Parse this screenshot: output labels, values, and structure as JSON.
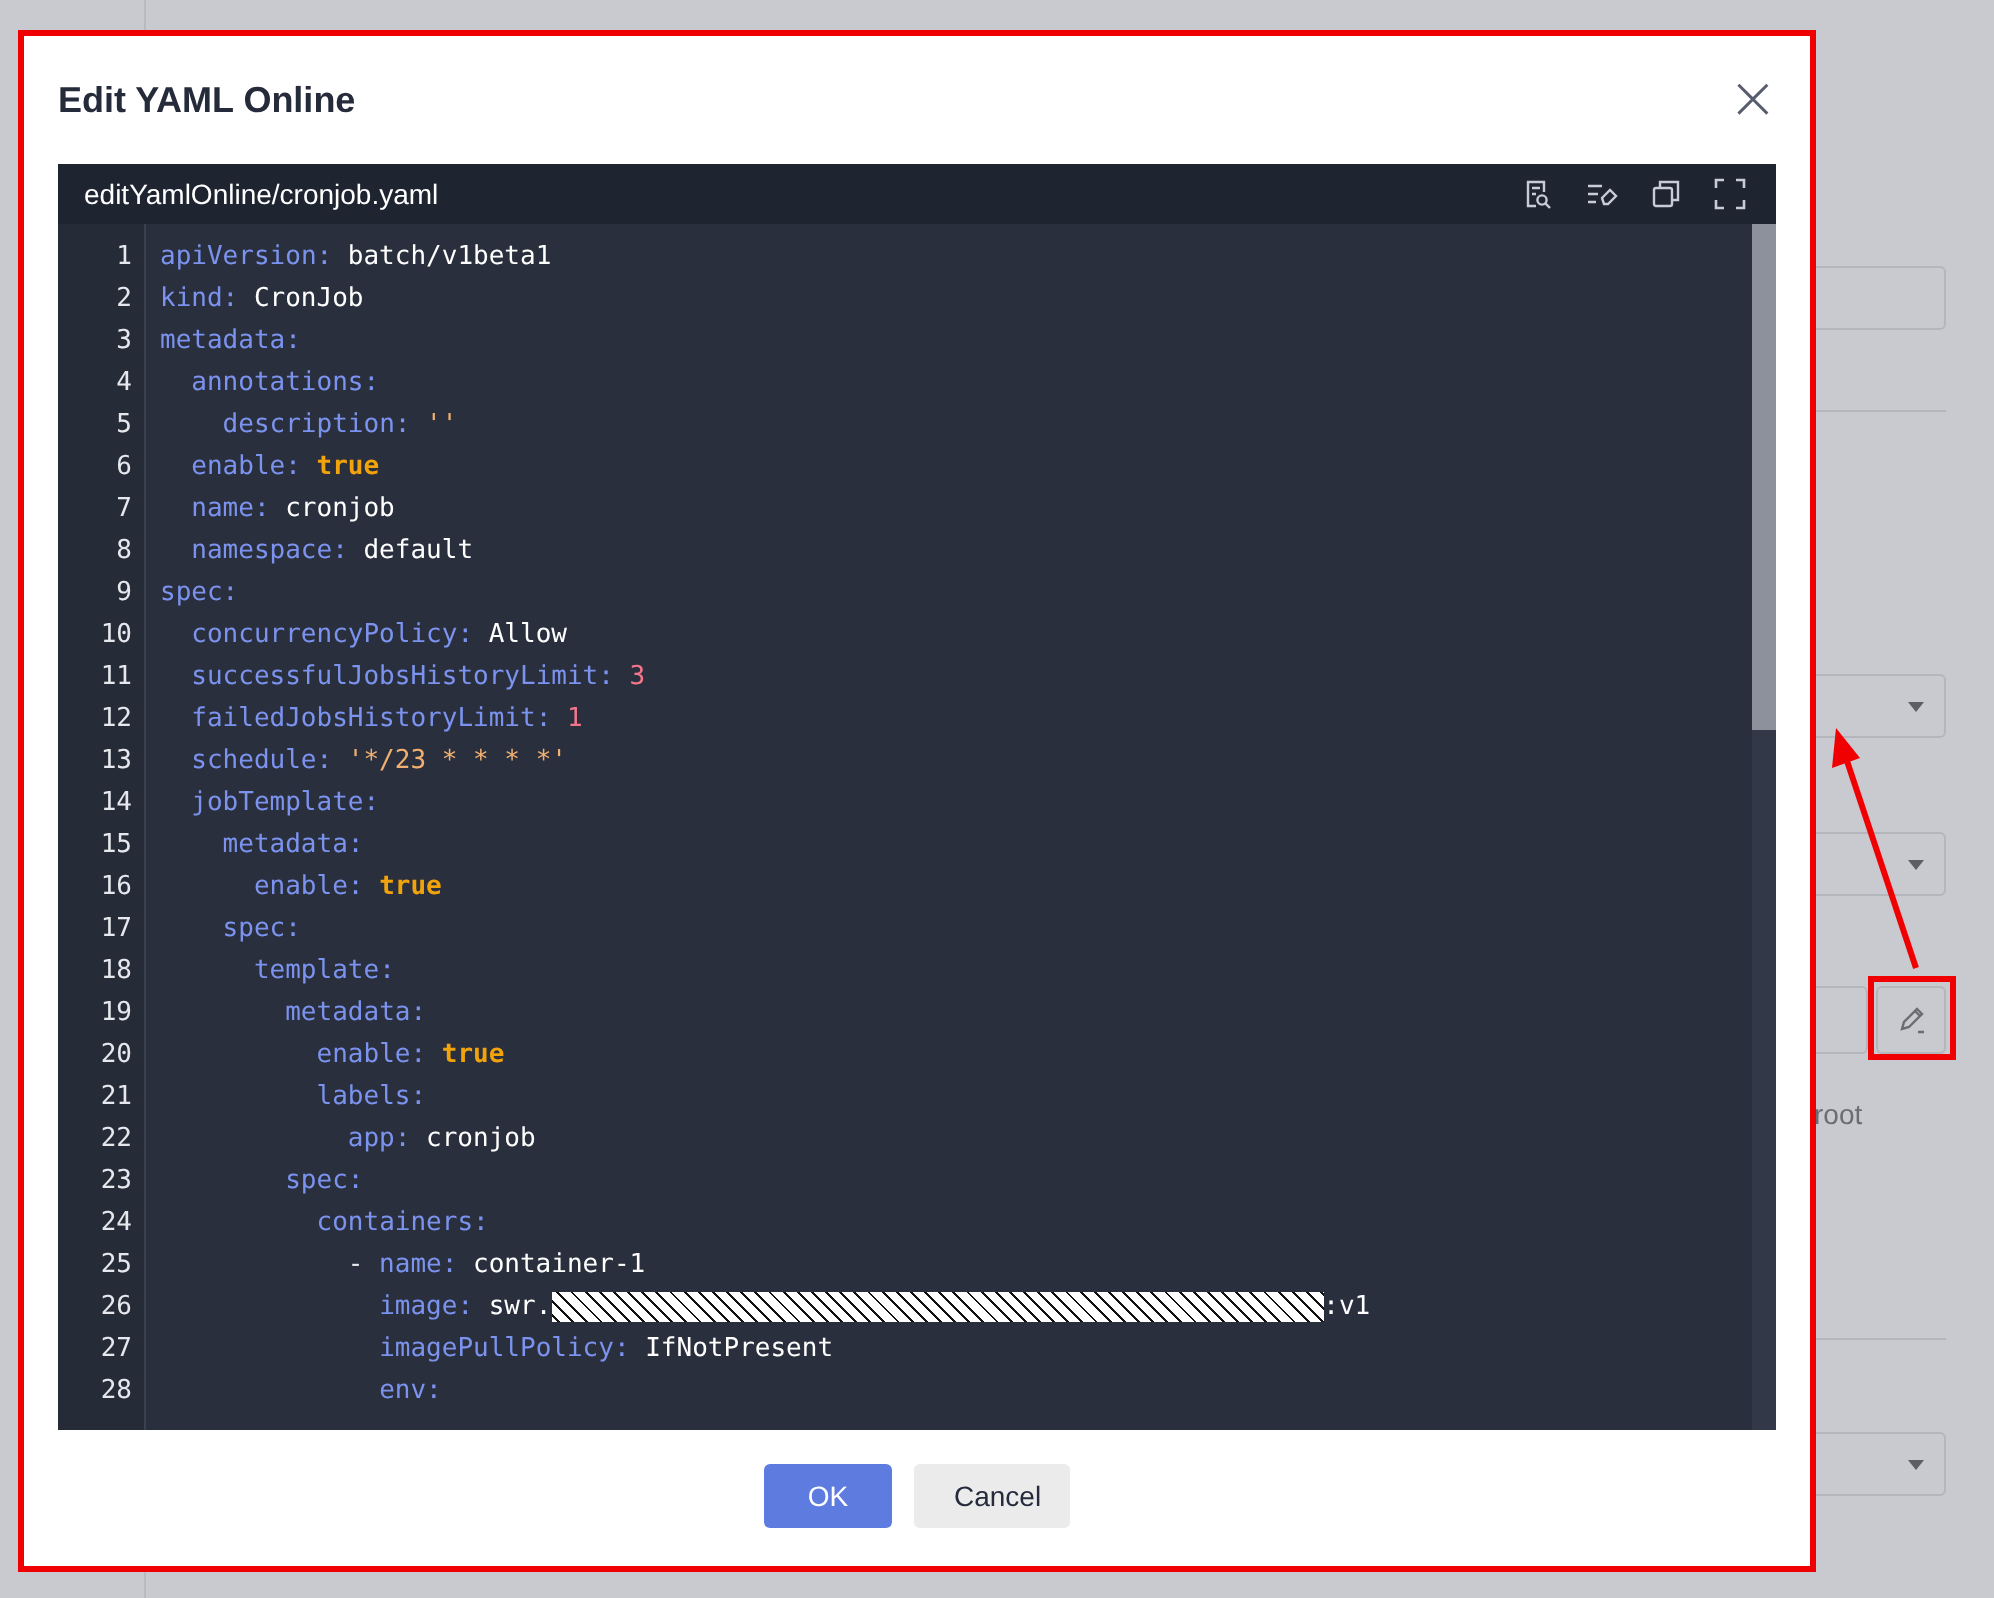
{
  "background": {
    "side_text": "root"
  },
  "dialog": {
    "title": "Edit YAML Online",
    "close": "×",
    "editor": {
      "file": "editYamlOnline/cronjob.yaml",
      "lines": [
        {
          "n": "1",
          "key": "apiVersion:",
          "value": "batch/v1beta1",
          "kind": "plain"
        },
        {
          "n": "2",
          "key": "kind:",
          "value": "CronJob",
          "kind": "plain"
        },
        {
          "n": "3",
          "key": "metadata:",
          "children": [
            {
              "n": "4",
              "key": "annotations:",
              "children": [
                {
                  "n": "5",
                  "key": "description:",
                  "value": "''",
                  "kind": "string"
                }
              ]
            },
            {
              "n": "6",
              "key": "enable:",
              "value": "true",
              "kind": "bool"
            },
            {
              "n": "7",
              "key": "name:",
              "value": "cronjob",
              "kind": "plain"
            },
            {
              "n": "8",
              "key": "namespace:",
              "value": "default",
              "kind": "plain"
            }
          ]
        },
        {
          "n": "9",
          "key": "spec:",
          "children": [
            {
              "n": "10",
              "key": "concurrencyPolicy:",
              "value": "Allow",
              "kind": "plain"
            },
            {
              "n": "11",
              "key": "successfulJobsHistoryLimit:",
              "value": "3",
              "kind": "number"
            },
            {
              "n": "12",
              "key": "failedJobsHistoryLimit:",
              "value": "1",
              "kind": "number"
            },
            {
              "n": "13",
              "key": "schedule:",
              "value": "'*/23 * * * *'",
              "kind": "string"
            },
            {
              "n": "14",
              "key": "jobTemplate:",
              "children": [
                {
                  "n": "15",
                  "key": "metadata:",
                  "children": [
                    {
                      "n": "16",
                      "key": "enable:",
                      "value": "true",
                      "kind": "bool"
                    }
                  ]
                },
                {
                  "n": "17",
                  "key": "spec:",
                  "children": [
                    {
                      "n": "18",
                      "key": "template:",
                      "children": [
                        {
                          "n": "19",
                          "key": "metadata:",
                          "children": [
                            {
                              "n": "20",
                              "key": "enable:",
                              "value": "true",
                              "kind": "bool"
                            },
                            {
                              "n": "21",
                              "key": "labels:",
                              "children": [
                                {
                                  "n": "22",
                                  "key": "app:",
                                  "value": "cronjob",
                                  "kind": "plain"
                                }
                              ]
                            }
                          ]
                        },
                        {
                          "n": "23",
                          "key": "spec:",
                          "children": [
                            {
                              "n": "24",
                              "key": "containers:",
                              "children": [
                                {
                                  "n": "25",
                                  "dash": "-",
                                  "key": "name:",
                                  "value": "container-1",
                                  "kind": "plain"
                                },
                                {
                                  "n": "26",
                                  "key": "image:",
                                  "value": "swr.",
                                  "after": ":v1",
                                  "kind": "redacted"
                                },
                                {
                                  "n": "27",
                                  "key": "imagePullPolicy:",
                                  "value": "IfNotPresent",
                                  "kind": "plain"
                                },
                                {
                                  "n": "28",
                                  "key": "env:"
                                }
                              ]
                            }
                          ]
                        }
                      ]
                    }
                  ]
                }
              ]
            }
          ]
        }
      ]
    },
    "buttons": [
      {
        "label": "OK",
        "kind": "primary"
      },
      {
        "label": "Cancel",
        "kind": "secondary"
      }
    ]
  }
}
